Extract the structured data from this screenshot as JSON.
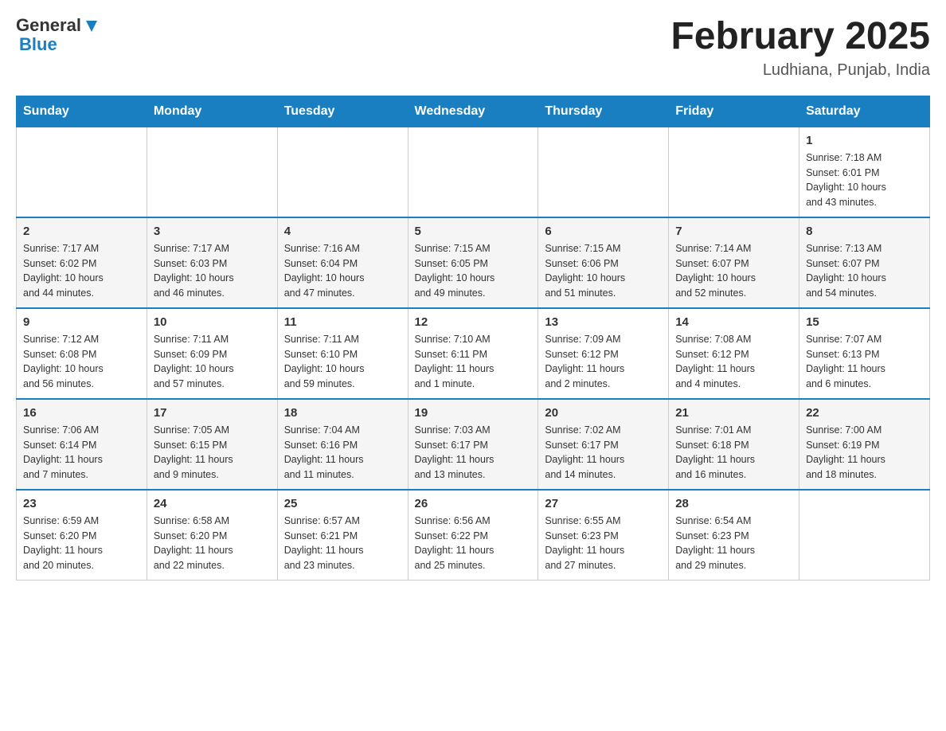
{
  "header": {
    "logo_general": "General",
    "logo_blue": "Blue",
    "month_title": "February 2025",
    "location": "Ludhiana, Punjab, India"
  },
  "days_of_week": [
    "Sunday",
    "Monday",
    "Tuesday",
    "Wednesday",
    "Thursday",
    "Friday",
    "Saturday"
  ],
  "weeks": [
    [
      {
        "day": "",
        "info": ""
      },
      {
        "day": "",
        "info": ""
      },
      {
        "day": "",
        "info": ""
      },
      {
        "day": "",
        "info": ""
      },
      {
        "day": "",
        "info": ""
      },
      {
        "day": "",
        "info": ""
      },
      {
        "day": "1",
        "info": "Sunrise: 7:18 AM\nSunset: 6:01 PM\nDaylight: 10 hours\nand 43 minutes."
      }
    ],
    [
      {
        "day": "2",
        "info": "Sunrise: 7:17 AM\nSunset: 6:02 PM\nDaylight: 10 hours\nand 44 minutes."
      },
      {
        "day": "3",
        "info": "Sunrise: 7:17 AM\nSunset: 6:03 PM\nDaylight: 10 hours\nand 46 minutes."
      },
      {
        "day": "4",
        "info": "Sunrise: 7:16 AM\nSunset: 6:04 PM\nDaylight: 10 hours\nand 47 minutes."
      },
      {
        "day": "5",
        "info": "Sunrise: 7:15 AM\nSunset: 6:05 PM\nDaylight: 10 hours\nand 49 minutes."
      },
      {
        "day": "6",
        "info": "Sunrise: 7:15 AM\nSunset: 6:06 PM\nDaylight: 10 hours\nand 51 minutes."
      },
      {
        "day": "7",
        "info": "Sunrise: 7:14 AM\nSunset: 6:07 PM\nDaylight: 10 hours\nand 52 minutes."
      },
      {
        "day": "8",
        "info": "Sunrise: 7:13 AM\nSunset: 6:07 PM\nDaylight: 10 hours\nand 54 minutes."
      }
    ],
    [
      {
        "day": "9",
        "info": "Sunrise: 7:12 AM\nSunset: 6:08 PM\nDaylight: 10 hours\nand 56 minutes."
      },
      {
        "day": "10",
        "info": "Sunrise: 7:11 AM\nSunset: 6:09 PM\nDaylight: 10 hours\nand 57 minutes."
      },
      {
        "day": "11",
        "info": "Sunrise: 7:11 AM\nSunset: 6:10 PM\nDaylight: 10 hours\nand 59 minutes."
      },
      {
        "day": "12",
        "info": "Sunrise: 7:10 AM\nSunset: 6:11 PM\nDaylight: 11 hours\nand 1 minute."
      },
      {
        "day": "13",
        "info": "Sunrise: 7:09 AM\nSunset: 6:12 PM\nDaylight: 11 hours\nand 2 minutes."
      },
      {
        "day": "14",
        "info": "Sunrise: 7:08 AM\nSunset: 6:12 PM\nDaylight: 11 hours\nand 4 minutes."
      },
      {
        "day": "15",
        "info": "Sunrise: 7:07 AM\nSunset: 6:13 PM\nDaylight: 11 hours\nand 6 minutes."
      }
    ],
    [
      {
        "day": "16",
        "info": "Sunrise: 7:06 AM\nSunset: 6:14 PM\nDaylight: 11 hours\nand 7 minutes."
      },
      {
        "day": "17",
        "info": "Sunrise: 7:05 AM\nSunset: 6:15 PM\nDaylight: 11 hours\nand 9 minutes."
      },
      {
        "day": "18",
        "info": "Sunrise: 7:04 AM\nSunset: 6:16 PM\nDaylight: 11 hours\nand 11 minutes."
      },
      {
        "day": "19",
        "info": "Sunrise: 7:03 AM\nSunset: 6:17 PM\nDaylight: 11 hours\nand 13 minutes."
      },
      {
        "day": "20",
        "info": "Sunrise: 7:02 AM\nSunset: 6:17 PM\nDaylight: 11 hours\nand 14 minutes."
      },
      {
        "day": "21",
        "info": "Sunrise: 7:01 AM\nSunset: 6:18 PM\nDaylight: 11 hours\nand 16 minutes."
      },
      {
        "day": "22",
        "info": "Sunrise: 7:00 AM\nSunset: 6:19 PM\nDaylight: 11 hours\nand 18 minutes."
      }
    ],
    [
      {
        "day": "23",
        "info": "Sunrise: 6:59 AM\nSunset: 6:20 PM\nDaylight: 11 hours\nand 20 minutes."
      },
      {
        "day": "24",
        "info": "Sunrise: 6:58 AM\nSunset: 6:20 PM\nDaylight: 11 hours\nand 22 minutes."
      },
      {
        "day": "25",
        "info": "Sunrise: 6:57 AM\nSunset: 6:21 PM\nDaylight: 11 hours\nand 23 minutes."
      },
      {
        "day": "26",
        "info": "Sunrise: 6:56 AM\nSunset: 6:22 PM\nDaylight: 11 hours\nand 25 minutes."
      },
      {
        "day": "27",
        "info": "Sunrise: 6:55 AM\nSunset: 6:23 PM\nDaylight: 11 hours\nand 27 minutes."
      },
      {
        "day": "28",
        "info": "Sunrise: 6:54 AM\nSunset: 6:23 PM\nDaylight: 11 hours\nand 29 minutes."
      },
      {
        "day": "",
        "info": ""
      }
    ]
  ]
}
